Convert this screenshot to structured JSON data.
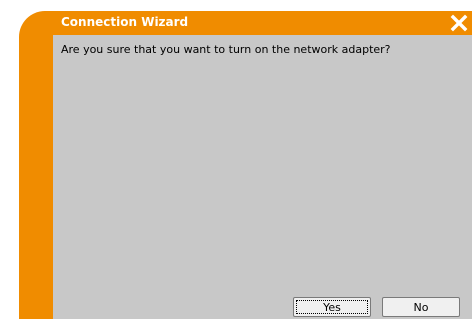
{
  "window": {
    "title": "Connection Wizard",
    "close_icon": "close-x-icon"
  },
  "dialog": {
    "message": "Are you sure that you want to turn on the network adapter?"
  },
  "buttons": {
    "yes_label": "Yes",
    "no_label": "No"
  },
  "colors": {
    "frame": "#f08c00",
    "content_background": "#c8c8c8",
    "title_text": "#ffffff"
  }
}
